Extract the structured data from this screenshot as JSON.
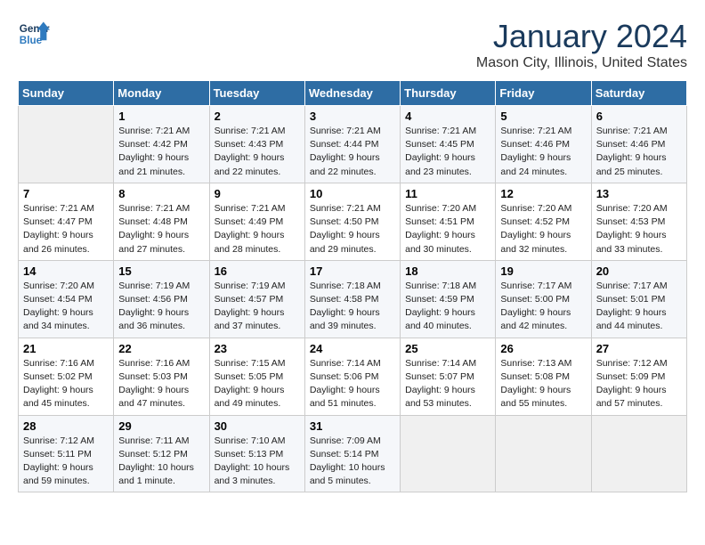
{
  "header": {
    "logo_line1": "General",
    "logo_line2": "Blue",
    "month_title": "January 2024",
    "location": "Mason City, Illinois, United States"
  },
  "weekdays": [
    "Sunday",
    "Monday",
    "Tuesday",
    "Wednesday",
    "Thursday",
    "Friday",
    "Saturday"
  ],
  "weeks": [
    [
      {
        "day": "",
        "sunrise": "",
        "sunset": "",
        "daylight": ""
      },
      {
        "day": "1",
        "sunrise": "7:21 AM",
        "sunset": "4:42 PM",
        "daylight": "9 hours and 21 minutes."
      },
      {
        "day": "2",
        "sunrise": "7:21 AM",
        "sunset": "4:43 PM",
        "daylight": "9 hours and 22 minutes."
      },
      {
        "day": "3",
        "sunrise": "7:21 AM",
        "sunset": "4:44 PM",
        "daylight": "9 hours and 22 minutes."
      },
      {
        "day": "4",
        "sunrise": "7:21 AM",
        "sunset": "4:45 PM",
        "daylight": "9 hours and 23 minutes."
      },
      {
        "day": "5",
        "sunrise": "7:21 AM",
        "sunset": "4:46 PM",
        "daylight": "9 hours and 24 minutes."
      },
      {
        "day": "6",
        "sunrise": "7:21 AM",
        "sunset": "4:46 PM",
        "daylight": "9 hours and 25 minutes."
      }
    ],
    [
      {
        "day": "7",
        "sunrise": "7:21 AM",
        "sunset": "4:47 PM",
        "daylight": "9 hours and 26 minutes."
      },
      {
        "day": "8",
        "sunrise": "7:21 AM",
        "sunset": "4:48 PM",
        "daylight": "9 hours and 27 minutes."
      },
      {
        "day": "9",
        "sunrise": "7:21 AM",
        "sunset": "4:49 PM",
        "daylight": "9 hours and 28 minutes."
      },
      {
        "day": "10",
        "sunrise": "7:21 AM",
        "sunset": "4:50 PM",
        "daylight": "9 hours and 29 minutes."
      },
      {
        "day": "11",
        "sunrise": "7:20 AM",
        "sunset": "4:51 PM",
        "daylight": "9 hours and 30 minutes."
      },
      {
        "day": "12",
        "sunrise": "7:20 AM",
        "sunset": "4:52 PM",
        "daylight": "9 hours and 32 minutes."
      },
      {
        "day": "13",
        "sunrise": "7:20 AM",
        "sunset": "4:53 PM",
        "daylight": "9 hours and 33 minutes."
      }
    ],
    [
      {
        "day": "14",
        "sunrise": "7:20 AM",
        "sunset": "4:54 PM",
        "daylight": "9 hours and 34 minutes."
      },
      {
        "day": "15",
        "sunrise": "7:19 AM",
        "sunset": "4:56 PM",
        "daylight": "9 hours and 36 minutes."
      },
      {
        "day": "16",
        "sunrise": "7:19 AM",
        "sunset": "4:57 PM",
        "daylight": "9 hours and 37 minutes."
      },
      {
        "day": "17",
        "sunrise": "7:18 AM",
        "sunset": "4:58 PM",
        "daylight": "9 hours and 39 minutes."
      },
      {
        "day": "18",
        "sunrise": "7:18 AM",
        "sunset": "4:59 PM",
        "daylight": "9 hours and 40 minutes."
      },
      {
        "day": "19",
        "sunrise": "7:17 AM",
        "sunset": "5:00 PM",
        "daylight": "9 hours and 42 minutes."
      },
      {
        "day": "20",
        "sunrise": "7:17 AM",
        "sunset": "5:01 PM",
        "daylight": "9 hours and 44 minutes."
      }
    ],
    [
      {
        "day": "21",
        "sunrise": "7:16 AM",
        "sunset": "5:02 PM",
        "daylight": "9 hours and 45 minutes."
      },
      {
        "day": "22",
        "sunrise": "7:16 AM",
        "sunset": "5:03 PM",
        "daylight": "9 hours and 47 minutes."
      },
      {
        "day": "23",
        "sunrise": "7:15 AM",
        "sunset": "5:05 PM",
        "daylight": "9 hours and 49 minutes."
      },
      {
        "day": "24",
        "sunrise": "7:14 AM",
        "sunset": "5:06 PM",
        "daylight": "9 hours and 51 minutes."
      },
      {
        "day": "25",
        "sunrise": "7:14 AM",
        "sunset": "5:07 PM",
        "daylight": "9 hours and 53 minutes."
      },
      {
        "day": "26",
        "sunrise": "7:13 AM",
        "sunset": "5:08 PM",
        "daylight": "9 hours and 55 minutes."
      },
      {
        "day": "27",
        "sunrise": "7:12 AM",
        "sunset": "5:09 PM",
        "daylight": "9 hours and 57 minutes."
      }
    ],
    [
      {
        "day": "28",
        "sunrise": "7:12 AM",
        "sunset": "5:11 PM",
        "daylight": "9 hours and 59 minutes."
      },
      {
        "day": "29",
        "sunrise": "7:11 AM",
        "sunset": "5:12 PM",
        "daylight": "10 hours and 1 minute."
      },
      {
        "day": "30",
        "sunrise": "7:10 AM",
        "sunset": "5:13 PM",
        "daylight": "10 hours and 3 minutes."
      },
      {
        "day": "31",
        "sunrise": "7:09 AM",
        "sunset": "5:14 PM",
        "daylight": "10 hours and 5 minutes."
      },
      {
        "day": "",
        "sunrise": "",
        "sunset": "",
        "daylight": ""
      },
      {
        "day": "",
        "sunrise": "",
        "sunset": "",
        "daylight": ""
      },
      {
        "day": "",
        "sunrise": "",
        "sunset": "",
        "daylight": ""
      }
    ]
  ]
}
